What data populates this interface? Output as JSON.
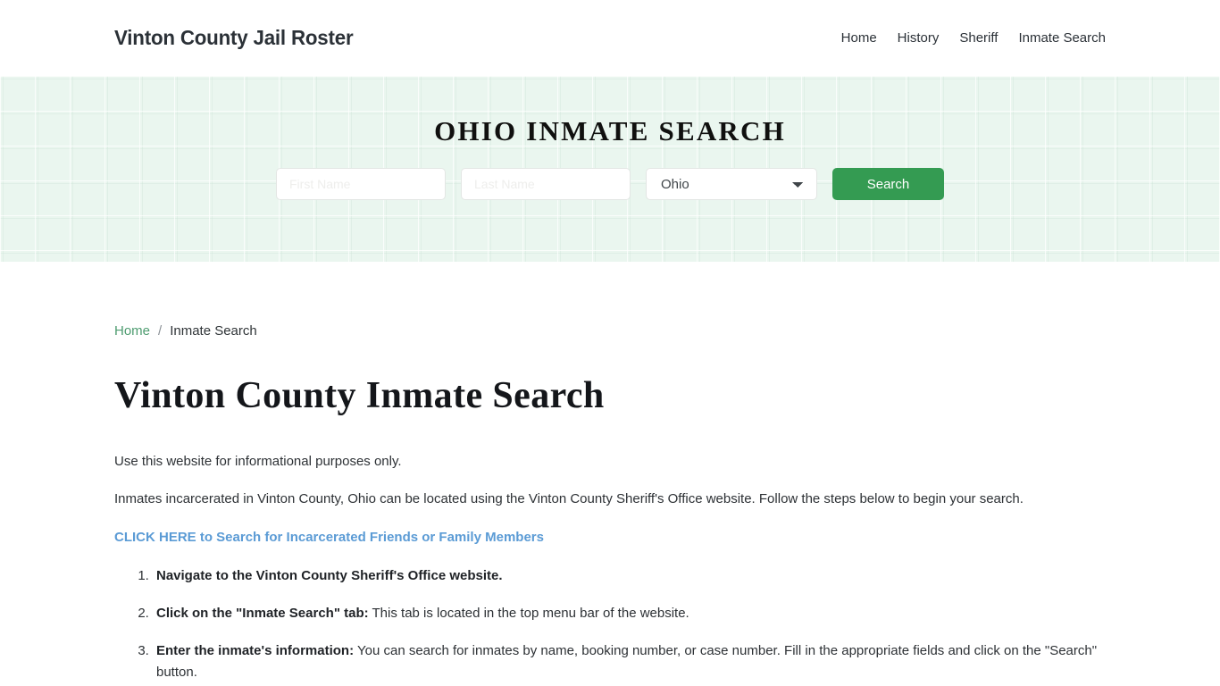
{
  "header": {
    "brand": "Vinton County Jail Roster",
    "nav": [
      {
        "label": "Home"
      },
      {
        "label": "History"
      },
      {
        "label": "Sheriff"
      },
      {
        "label": "Inmate Search"
      }
    ]
  },
  "hero": {
    "title": "OHIO INMATE SEARCH",
    "form": {
      "first_name_placeholder": "First Name",
      "first_name_value": "",
      "last_name_placeholder": "Last Name",
      "last_name_value": "",
      "state_selected": "Ohio",
      "state_options": [
        "Ohio"
      ],
      "search_label": "Search"
    },
    "accent_green": "#349b52",
    "background_green": "#eaf6ef"
  },
  "breadcrumb": {
    "home": "Home",
    "separator": "/",
    "current": "Inmate Search"
  },
  "main": {
    "title": "Vinton County Inmate Search",
    "paragraph_1": "Use this website for informational purposes only.",
    "paragraph_2": "Inmates incarcerated in Vinton County, Ohio can be located using the Vinton County Sheriff's Office website. Follow the steps below to begin your search.",
    "cta_link": "CLICK HERE to Search for Incarcerated Friends or Family Members",
    "cta_color": "#5b9bd5",
    "steps": [
      {
        "bold": "Navigate to the Vinton County Sheriff's Office website.",
        "rest": ""
      },
      {
        "bold": "Click on the \"Inmate Search\" tab:",
        "rest": " This tab is located in the top menu bar of the website."
      },
      {
        "bold": "Enter the inmate's information:",
        "rest": " You can search for inmates by name, booking number, or case number. Fill in the appropriate fields and click on the \"Search\" button."
      }
    ]
  }
}
